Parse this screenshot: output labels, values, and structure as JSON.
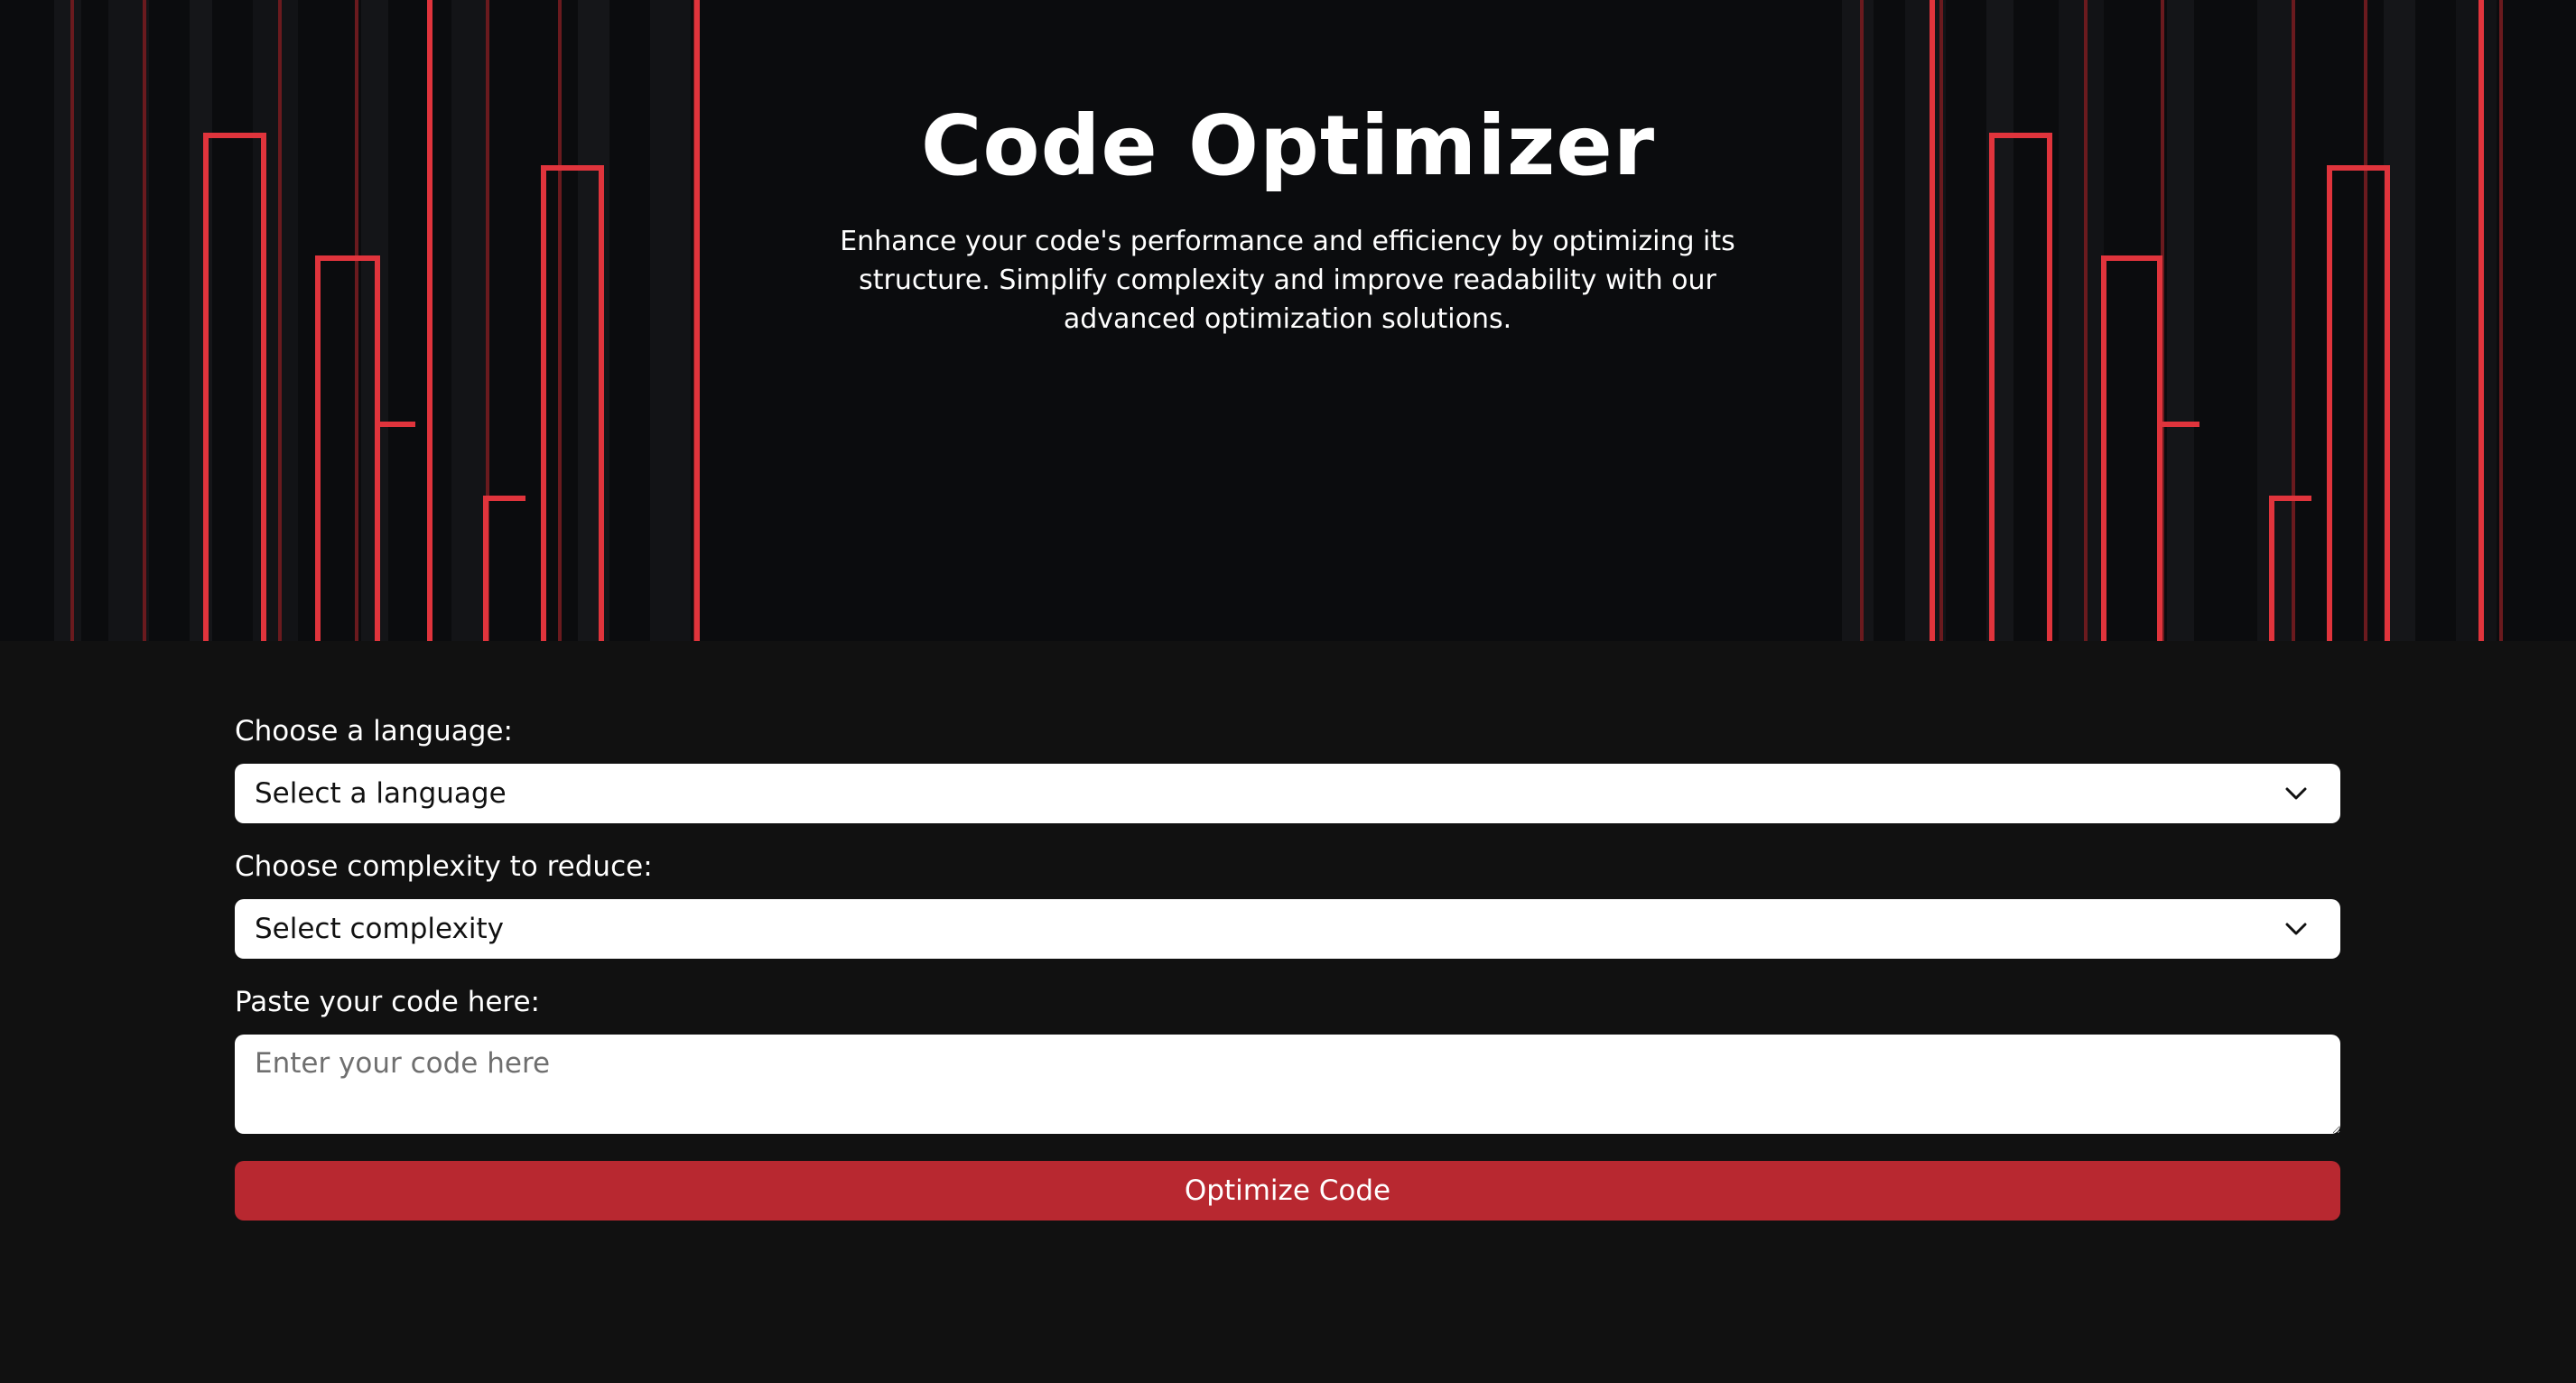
{
  "hero": {
    "title": "Code Optimizer",
    "description": "Enhance your code's performance and efficiency by optimizing its structure. Simplify complexity and improve readability with our advanced optimization solutions."
  },
  "form": {
    "language": {
      "label": "Choose a language:",
      "selected": "Select a language"
    },
    "complexity": {
      "label": "Choose complexity to reduce:",
      "selected": "Select complexity"
    },
    "code": {
      "label": "Paste your code here:",
      "value": "",
      "placeholder": "Enter your code here"
    },
    "submit_label": "Optimize Code"
  },
  "colors": {
    "background": "#111111",
    "hero_background": "#0b0c0e",
    "accent": "#b82830",
    "neon_line": "#e0343c"
  },
  "icons": {
    "dropdown": "chevron-down-icon"
  }
}
